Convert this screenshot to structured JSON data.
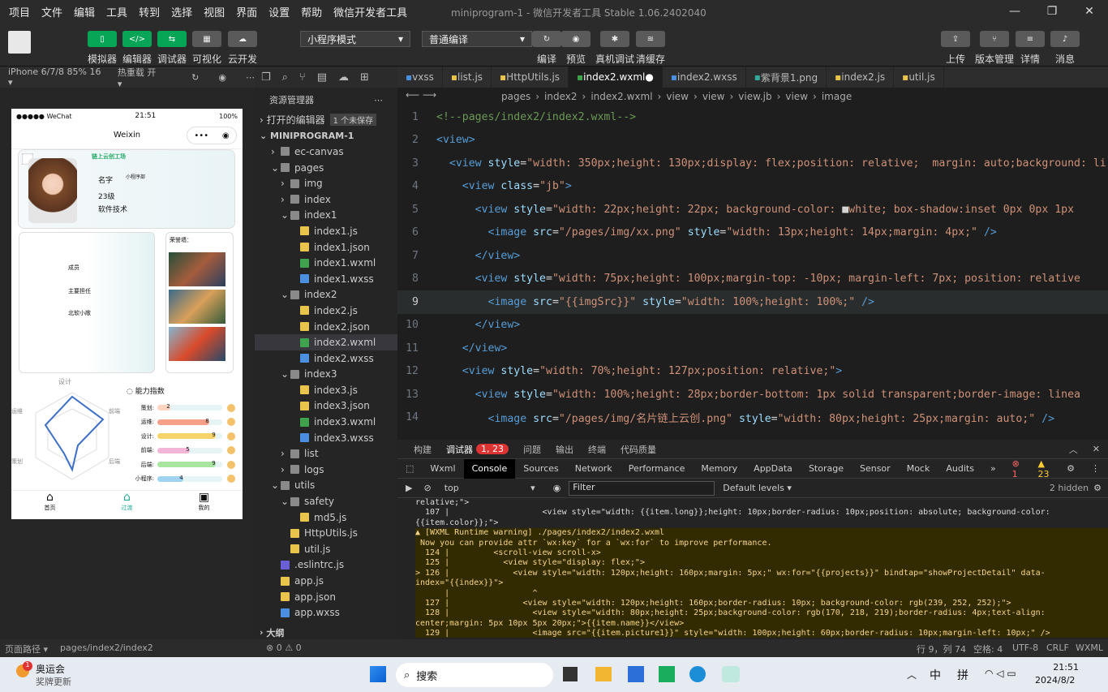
{
  "menu": [
    "项目",
    "文件",
    "编辑",
    "工具",
    "转到",
    "选择",
    "视图",
    "界面",
    "设置",
    "帮助",
    "微信开发者工具"
  ],
  "window_title": "miniprogram-1 - 微信开发者工具 Stable 1.06.2402040",
  "toolbar": {
    "simulator": "模拟器",
    "editor": "编辑器",
    "debugger": "调试器",
    "visual": "可视化",
    "cloud": "云开发",
    "mode": "小程序模式",
    "compile_mode": "普通编译",
    "compile": "编译",
    "preview": "预览",
    "real_debug": "真机调试",
    "clear_cache": "清缓存",
    "upload": "上传",
    "version": "版本管理",
    "details": "详情",
    "messages": "消息"
  },
  "device": {
    "model": "iPhone 6/7/8 85% 16 ▾",
    "hot_reload": "热重载 开 ▾"
  },
  "phone": {
    "carrier": "●●●●● WeChat",
    "time": "21:51",
    "battery": "100%",
    "title": "Weixin",
    "card": {
      "brand": "链上云创工场",
      "name_label": "名字",
      "dept": "小程序部",
      "grade": "23级",
      "major": "软件技术"
    },
    "left_items": [
      "成员",
      "主要担任",
      "北软小敞"
    ],
    "honor_label": "荣誉墙：",
    "design_label": "设计",
    "ability_title": "能力指数",
    "radar_labels": [
      "前端",
      "后端",
      "策划",
      "运维"
    ],
    "skills": [
      {
        "name": "策划:",
        "value": "2",
        "pct": 0.2,
        "color": "#ffd5c2"
      },
      {
        "name": "运维:",
        "value": "8",
        "pct": 0.8,
        "color": "#f6a08a"
      },
      {
        "name": "设计:",
        "value": "9",
        "pct": 0.9,
        "color": "#f7d46b"
      },
      {
        "name": "前端:",
        "value": "5",
        "pct": 0.5,
        "color": "#f2b6d6"
      },
      {
        "name": "后端:",
        "value": "9",
        "pct": 0.9,
        "color": "#a8e6a0"
      },
      {
        "name": "小程序:",
        "value": "4",
        "pct": 0.4,
        "color": "#9fd3ef"
      }
    ],
    "tabs": [
      "首页",
      "过渡",
      "我的"
    ]
  },
  "explorer": {
    "title": "资源管理器",
    "open_editors": "打开的编辑器",
    "unsaved": "1 个未保存",
    "project": "MINIPROGRAM-1",
    "outline": "大纲",
    "rows": [
      {
        "d": 1,
        "t": "ec-canvas",
        "k": "folder"
      },
      {
        "d": 1,
        "t": "pages",
        "k": "folderopen"
      },
      {
        "d": 2,
        "t": "img",
        "k": "folder"
      },
      {
        "d": 2,
        "t": "index",
        "k": "folder"
      },
      {
        "d": 2,
        "t": "index1",
        "k": "folderopen"
      },
      {
        "d": 3,
        "t": "index1.js",
        "k": "js"
      },
      {
        "d": 3,
        "t": "index1.json",
        "k": "json"
      },
      {
        "d": 3,
        "t": "index1.wxml",
        "k": "wxml"
      },
      {
        "d": 3,
        "t": "index1.wxss",
        "k": "wxss"
      },
      {
        "d": 2,
        "t": "index2",
        "k": "folderopen"
      },
      {
        "d": 3,
        "t": "index2.js",
        "k": "js"
      },
      {
        "d": 3,
        "t": "index2.json",
        "k": "json"
      },
      {
        "d": 3,
        "t": "index2.wxml",
        "k": "wxml",
        "sel": true
      },
      {
        "d": 3,
        "t": "index2.wxss",
        "k": "wxss"
      },
      {
        "d": 2,
        "t": "index3",
        "k": "folderopen"
      },
      {
        "d": 3,
        "t": "index3.js",
        "k": "js"
      },
      {
        "d": 3,
        "t": "index3.json",
        "k": "json"
      },
      {
        "d": 3,
        "t": "index3.wxml",
        "k": "wxml"
      },
      {
        "d": 3,
        "t": "index3.wxss",
        "k": "wxss"
      },
      {
        "d": 2,
        "t": "list",
        "k": "folder"
      },
      {
        "d": 2,
        "t": "logs",
        "k": "folder"
      },
      {
        "d": 1,
        "t": "utils",
        "k": "folderopen"
      },
      {
        "d": 2,
        "t": "safety",
        "k": "folderopen"
      },
      {
        "d": 3,
        "t": "md5.js",
        "k": "js"
      },
      {
        "d": 2,
        "t": "HttpUtils.js",
        "k": "js"
      },
      {
        "d": 2,
        "t": "util.js",
        "k": "js"
      },
      {
        "d": 1,
        "t": ".eslintrc.js",
        "k": "eslint"
      },
      {
        "d": 1,
        "t": "app.js",
        "k": "js"
      },
      {
        "d": 1,
        "t": "app.json",
        "k": "json"
      },
      {
        "d": 1,
        "t": "app.wxss",
        "k": "wxss"
      }
    ]
  },
  "tabs": [
    {
      "t": "vxss"
    },
    {
      "t": "list.js"
    },
    {
      "t": "HttpUtils.js"
    },
    {
      "t": "index2.wxml",
      "active": true
    },
    {
      "t": "index2.wxss"
    },
    {
      "t": "紫背景1.png"
    },
    {
      "t": "index2.js"
    },
    {
      "t": "util.js"
    }
  ],
  "breadcrumb": [
    "pages",
    "index2",
    "index2.wxml",
    "view",
    "view",
    "view.jb",
    "view",
    "image"
  ],
  "code": [
    {
      "n": "1",
      "h": [
        [
          "cm",
          "<!--pages/index2/index2.wxml-->"
        ]
      ]
    },
    {
      "n": "2",
      "h": [
        [
          "tg",
          "<view"
        ],
        [
          "tg",
          ">"
        ]
      ]
    },
    {
      "n": "3",
      "h": [
        [
          "pl",
          "  "
        ],
        [
          "tg",
          "<view "
        ],
        [
          "at",
          "style"
        ],
        [
          "pl",
          "="
        ],
        [
          "st",
          "\"width: 350px;height: 130px;display: flex;position: relative;  margin: auto;background: li"
        ]
      ]
    },
    {
      "n": "4",
      "h": [
        [
          "pl",
          "    "
        ],
        [
          "tg",
          "<view "
        ],
        [
          "at",
          "class"
        ],
        [
          "pl",
          "="
        ],
        [
          "st",
          "\"jb\""
        ],
        [
          "tg",
          ">"
        ]
      ]
    },
    {
      "n": "5",
      "h": [
        [
          "pl",
          "      "
        ],
        [
          "tg",
          "<view "
        ],
        [
          "at",
          "style"
        ],
        [
          "pl",
          "="
        ],
        [
          "st",
          "\"width: 22px;height: 22px; background-color: "
        ],
        [
          "pl",
          "■"
        ],
        [
          "st",
          "white; box-shadow:inset 0px 0px 1px"
        ]
      ]
    },
    {
      "n": "6",
      "h": [
        [
          "pl",
          "        "
        ],
        [
          "tg",
          "<image "
        ],
        [
          "at",
          "src"
        ],
        [
          "pl",
          "="
        ],
        [
          "st",
          "\"/pages/img/xx.png\" "
        ],
        [
          "at",
          "style"
        ],
        [
          "pl",
          "="
        ],
        [
          "st",
          "\"width: 13px;height: 14px;margin: 4px;\" "
        ],
        [
          "tg",
          "/>"
        ]
      ]
    },
    {
      "n": "7",
      "h": [
        [
          "pl",
          "      "
        ],
        [
          "tg",
          "</view>"
        ]
      ]
    },
    {
      "n": "8",
      "h": [
        [
          "pl",
          "      "
        ],
        [
          "tg",
          "<view "
        ],
        [
          "at",
          "style"
        ],
        [
          "pl",
          "="
        ],
        [
          "st",
          "\"width: 75px;height: 100px;margin-top: -10px; margin-left: 7px; position: relative"
        ]
      ]
    },
    {
      "n": "9",
      "h": [
        [
          "pl",
          "        "
        ],
        [
          "tg",
          "<image "
        ],
        [
          "at",
          "src"
        ],
        [
          "pl",
          "="
        ],
        [
          "st",
          "\"{{imgSrc}}\" "
        ],
        [
          "at",
          "style"
        ],
        [
          "pl",
          "="
        ],
        [
          "st",
          "\"width: 100%;height: 100%;\" "
        ],
        [
          "tg",
          "/>"
        ]
      ]
    },
    {
      "n": "10",
      "h": [
        [
          "pl",
          "      "
        ],
        [
          "tg",
          "</view>"
        ]
      ]
    },
    {
      "n": "11",
      "h": [
        [
          "pl",
          "    "
        ],
        [
          "tg",
          "</view>"
        ]
      ]
    },
    {
      "n": "12",
      "h": [
        [
          "pl",
          "    "
        ],
        [
          "tg",
          "<view "
        ],
        [
          "at",
          "style"
        ],
        [
          "pl",
          "="
        ],
        [
          "st",
          "\"width: 70%;height: 127px;position: relative;\""
        ],
        [
          "tg",
          ">"
        ]
      ]
    },
    {
      "n": "13",
      "h": [
        [
          "pl",
          "      "
        ],
        [
          "tg",
          "<view "
        ],
        [
          "at",
          "style"
        ],
        [
          "pl",
          "="
        ],
        [
          "st",
          "\"width: 100%;height: 28px;border-bottom: 1px solid transparent;border-image: linea"
        ]
      ]
    },
    {
      "n": "14",
      "h": [
        [
          "pl",
          "        "
        ],
        [
          "tg",
          "<image "
        ],
        [
          "at",
          "src"
        ],
        [
          "pl",
          "="
        ],
        [
          "st",
          "\"/pages/img/名片链上云创.png\" "
        ],
        [
          "at",
          "style"
        ],
        [
          "pl",
          "="
        ],
        [
          "st",
          "\"width: 80px;height: 25px;margin: auto;\" "
        ],
        [
          "tg",
          "/>"
        ]
      ]
    }
  ],
  "devtools": {
    "top_tabs": [
      "构建",
      "调试器",
      "问题",
      "输出",
      "终端",
      "代码质量"
    ],
    "badge": "1, 23",
    "tabs": [
      "Wxml",
      "Console",
      "Sources",
      "Network",
      "Performance",
      "Memory",
      "AppData",
      "Storage",
      "Sensor",
      "Mock",
      "Audits"
    ],
    "errors": "1",
    "warnings": "23",
    "context": "top",
    "filter_placeholder": "Filter",
    "levels": "Default levels ▾",
    "hidden": "2 hidden",
    "lines": [
      {
        "w": false,
        "t": "relative;\">"
      },
      {
        "w": false,
        "t": "  107 |                   <view style=\"width: {{item.long}};height: 10px;border-radius: 10px;position: absolute; background-color:"
      },
      {
        "w": false,
        "t": "{{item.color}};\">"
      },
      {
        "w": true,
        "t": "▲ [WXML Runtime warning] ./pages/index2/index2.wxml"
      },
      {
        "w": true,
        "t": " Now you can provide attr `wx:key` for a `wx:for` to improve performance."
      },
      {
        "w": true,
        "t": "  124 |         <scroll-view scroll-x>"
      },
      {
        "w": true,
        "t": "  125 |           <view style=\"display: flex;\">"
      },
      {
        "w": true,
        "t": "> 126 |             <view style=\"width: 120px;height: 160px;margin: 5px;\" wx:for=\"{{projects}}\" bindtap=\"showProjectDetail\" data-"
      },
      {
        "w": true,
        "t": "index=\"{{index}}\">"
      },
      {
        "w": true,
        "t": "      |                 ^"
      },
      {
        "w": true,
        "t": "  127 |               <view style=\"width: 120px;height: 160px;border-radius: 10px; background-color: rgb(239, 252, 252);\">"
      },
      {
        "w": true,
        "t": "  128 |                 <view style=\"width: 80px;height: 25px;background-color: rgb(170, 218, 219);border-radius: 4px;text-align:"
      },
      {
        "w": true,
        "t": "center;margin: 5px 10px 5px 20px;\">{{item.name}}</view>"
      },
      {
        "w": true,
        "t": "  129 |                 <image src=\"{{item.picture1}}\" style=\"width: 100px;height: 60px;border-radius: 10px;margin-left: 10px;\" />"
      }
    ]
  },
  "status": {
    "page_path_label": "页面路径 ▾",
    "page_path": "pages/index2/index2",
    "errors": "⊗ 0 ⚠ 0",
    "cursor": "行 9，列 74",
    "spaces": "空格: 4",
    "encoding": "UTF-8",
    "eol": "CRLF",
    "lang": "WXML"
  },
  "taskbar": {
    "news_title": "奥运会",
    "news_sub": "奖牌更新",
    "news_badge": "1",
    "search": "搜索",
    "ime1": "中",
    "ime2": "拼",
    "time": "21:51",
    "date": "2024/8/2"
  }
}
